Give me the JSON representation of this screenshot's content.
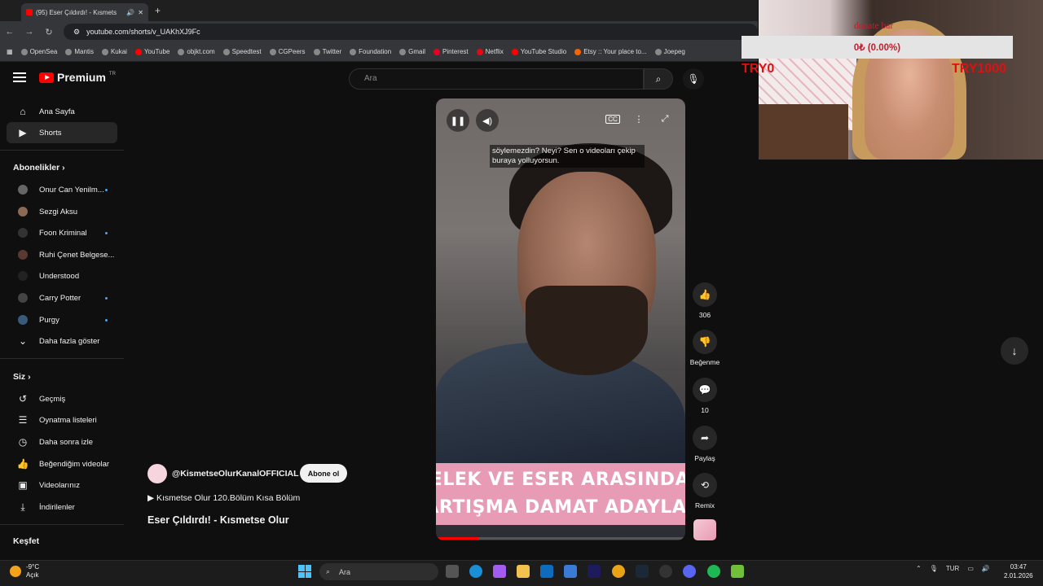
{
  "browser": {
    "tab_title": "(95) Eser Çıldırdı! - Kısmets",
    "url": "youtube.com/shorts/v_UAKhXJ9Fc",
    "bookmarks": [
      "OpenSea",
      "Mantis",
      "Kukai",
      "YouTube",
      "objkt.com",
      "Speedtest",
      "CGPeers",
      "Twitter",
      "Foundation",
      "Gmail",
      "Pinterest",
      "Netflix",
      "YouTube Studio",
      "Etsy :: Your place to...",
      "Joepeg"
    ]
  },
  "youtube": {
    "logo_text": "Premium",
    "logo_region": "TR",
    "search_placeholder": "Ara"
  },
  "sidebar": {
    "main": [
      {
        "label": "Ana Sayfa",
        "icon": "home-icon"
      },
      {
        "label": "Shorts",
        "icon": "shorts-icon"
      }
    ],
    "subs_heading": "Abonelikler",
    "subscriptions": [
      {
        "label": "Onur Can Yenilm...",
        "dot": true
      },
      {
        "label": "Sezgi Aksu",
        "dot": false
      },
      {
        "label": "Foon Kriminal",
        "dot": true
      },
      {
        "label": "Ruhi Çenet Belgese...",
        "dot": false
      },
      {
        "label": "Understood",
        "dot": false
      },
      {
        "label": "Carry Potter",
        "dot": true
      },
      {
        "label": "Purgy",
        "dot": true
      }
    ],
    "show_more": "Daha fazla göster",
    "you_heading": "Siz",
    "you_items": [
      {
        "label": "Geçmiş",
        "icon": "history-icon"
      },
      {
        "label": "Oynatma listeleri",
        "icon": "playlist-icon"
      },
      {
        "label": "Daha sonra izle",
        "icon": "clock-icon"
      },
      {
        "label": "Beğendiğim videolar",
        "icon": "thumb-up-icon"
      },
      {
        "label": "Videolarınız",
        "icon": "video-icon"
      },
      {
        "label": "İndirilenler",
        "icon": "download-icon"
      }
    ],
    "explore_heading": "Keşfet"
  },
  "short": {
    "caption": "söylemezdin? Neyi? Sen o videoları çekip buraya yolluyorsun.",
    "banner_line1": "MELEK VE ESER ARASINDA Y",
    "banner_line2": "TARTIŞMA DAMAT ADAYLARI",
    "progress": 0.17,
    "channel": "@KismetseOlurKanalOFFICIAL",
    "subscribe": "Abone ol",
    "playlist": "Kısmetse Olur 120.Bölüm Kısa Bölüm",
    "title": "Eser Çıldırdı!  - Kısmetse Olur"
  },
  "actions": {
    "likes": "306",
    "dislike": "Beğenme",
    "comments": "10",
    "share": "Paylaş",
    "remix": "Remix"
  },
  "overlay": {
    "donate_label": "donate bar",
    "donate_value": "0₺ (0.00%)",
    "left_goal": "TRY0",
    "right_goal": "TRY1000"
  },
  "taskbar": {
    "temp": "-9°C",
    "weather": "Açık",
    "search": "Ara",
    "lang": "TUR",
    "time": "03:47",
    "date": "2.01.2026"
  }
}
